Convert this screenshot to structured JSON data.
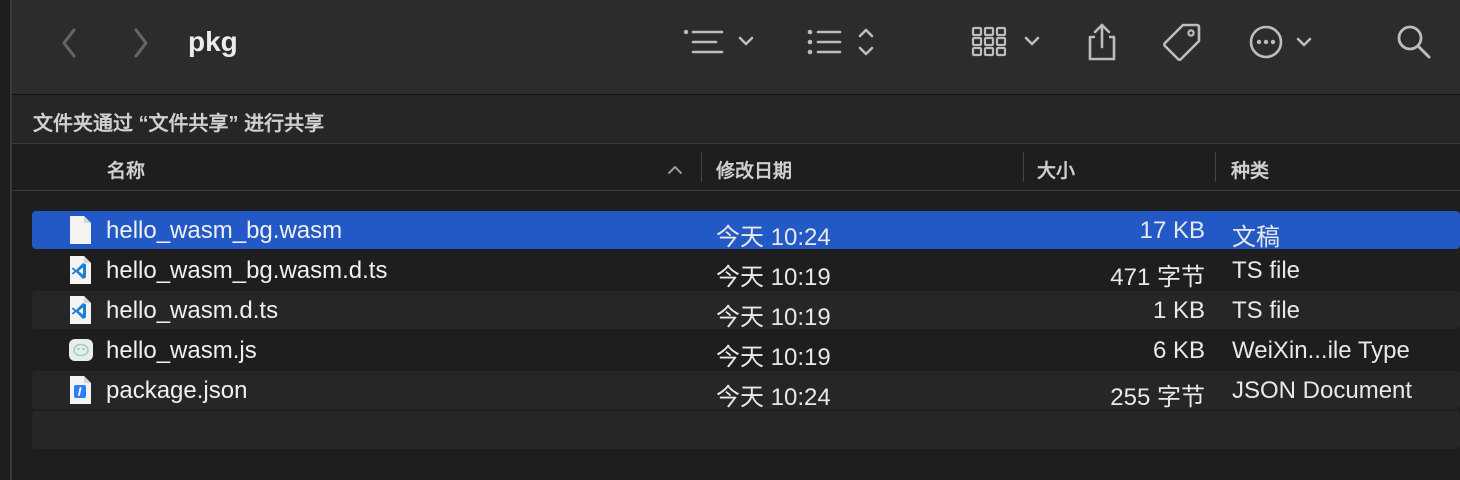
{
  "window": {
    "title": "pkg"
  },
  "toolbar": {
    "icons": [
      "back-icon",
      "forward-icon",
      "list-view-icon",
      "group-icon",
      "gallery-icon",
      "share-icon",
      "tag-icon",
      "more-icon",
      "search-icon"
    ]
  },
  "pathbar": {
    "text": "文件夹通过 “文件共享” 进行共享"
  },
  "columns": {
    "name": "名称",
    "date": "修改日期",
    "size": "大小",
    "kind": "种类"
  },
  "files": [
    {
      "name": "hello_wasm_bg.wasm",
      "date": "今天 10:24",
      "size": "17 KB",
      "kind": "文稿",
      "icon": "document-icon",
      "selected": true
    },
    {
      "name": "hello_wasm_bg.wasm.d.ts",
      "date": "今天 10:19",
      "size": "471 字节",
      "kind": "TS file",
      "icon": "vscode-file-icon"
    },
    {
      "name": "hello_wasm.d.ts",
      "date": "今天 10:19",
      "size": "1 KB",
      "kind": "TS file",
      "icon": "vscode-file-icon"
    },
    {
      "name": "hello_wasm.js",
      "date": "今天 10:19",
      "size": "6 KB",
      "kind": "WeiXin...ile Type",
      "icon": "wechat-file-icon"
    },
    {
      "name": "package.json",
      "date": "今天 10:24",
      "size": "255 字节",
      "kind": "JSON Document",
      "icon": "json-file-icon"
    }
  ],
  "colors": {
    "selection": "#2359c7",
    "background": "#1e1e1e",
    "toolbar": "#2c2c2e"
  }
}
